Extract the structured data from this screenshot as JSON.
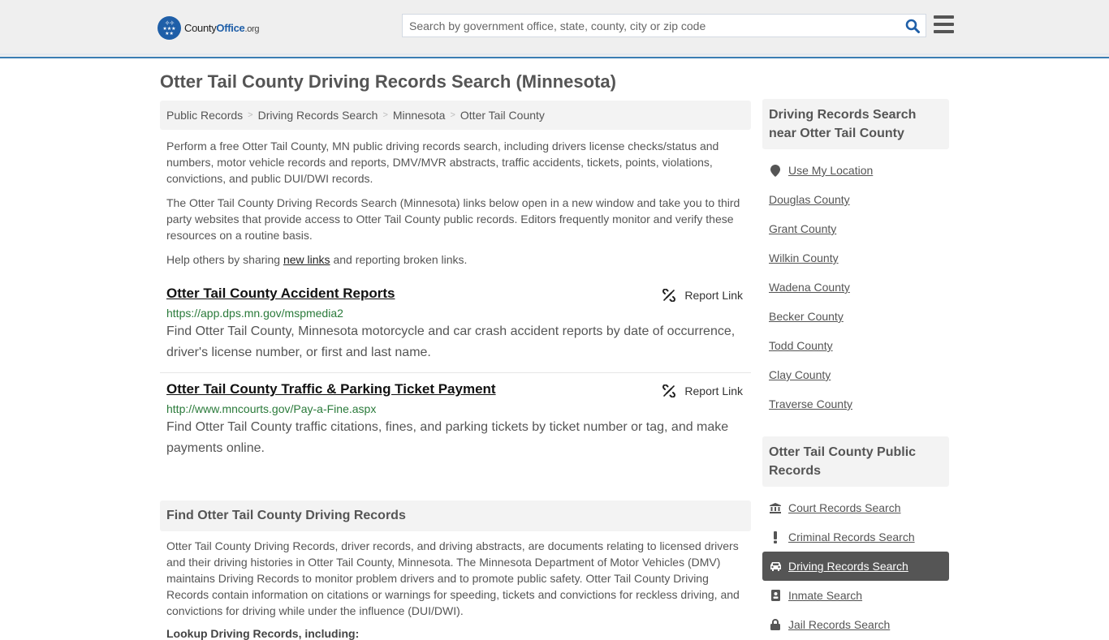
{
  "header": {
    "logo": {
      "county": "County",
      "office": "Office",
      "tld": ".org"
    },
    "search_placeholder": "Search by government office, state, county, city or zip code",
    "search_icon": "search-icon",
    "menu_icon": "hamburger-menu-icon",
    "accent_color": "#3a7db3"
  },
  "page": {
    "title": "Otter Tail County Driving Records Search (Minnesota)"
  },
  "breadcrumb": [
    {
      "label": "Public Records"
    },
    {
      "label": "Driving Records Search"
    },
    {
      "label": "Minnesota"
    },
    {
      "label": "Otter Tail County"
    }
  ],
  "intro": {
    "p1": "Perform a free Otter Tail County, MN public driving records search, including drivers license checks/status and numbers, motor vehicle records and reports, DMV/MVR abstracts, traffic accidents, tickets, points, violations, convictions, and public DUI/DWI records.",
    "p2": "The Otter Tail County Driving Records Search (Minnesota) links below open in a new window and take you to third party websites that provide access to Otter Tail County public records. Editors frequently monitor and verify these resources on a routine basis.",
    "p3_before": "Help others by sharing ",
    "p3_link": "new links",
    "p3_after": " and reporting broken links."
  },
  "links": [
    {
      "title": "Otter Tail County Accident Reports",
      "report_label": "Report Link",
      "url": "https://app.dps.mn.gov/mspmedia2",
      "description": "Find Otter Tail County, Minnesota motorcycle and car crash accident reports by date of occurrence, driver's license number, or first and last name."
    },
    {
      "title": "Otter Tail County Traffic & Parking Ticket Payment",
      "report_label": "Report Link",
      "url": "http://www.mncourts.gov/Pay-a-Fine.aspx",
      "description": "Find Otter Tail County traffic citations, fines, and parking tickets by ticket number or tag, and make payments online."
    }
  ],
  "find_section": {
    "heading": "Find Otter Tail County Driving Records",
    "body": "Otter Tail County Driving Records, driver records, and driving abstracts, are documents relating to licensed drivers and their driving histories in Otter Tail County, Minnesota. The Minnesota Department of Motor Vehicles (DMV) maintains Driving Records to monitor problem drivers and to promote public safety. Otter Tail County Driving Records contain information on citations or warnings for speeding, tickets and convictions for reckless driving, and convictions for driving while under the influence (DUI/DWI).",
    "subheading": "Lookup Driving Records, including:"
  },
  "sidebar": {
    "nearby_heading": "Driving Records Search near Otter Tail County",
    "use_location": "Use My Location",
    "nearby": [
      {
        "label": "Douglas County"
      },
      {
        "label": "Grant County"
      },
      {
        "label": "Wilkin County"
      },
      {
        "label": "Wadena County"
      },
      {
        "label": "Becker County"
      },
      {
        "label": "Todd County"
      },
      {
        "label": "Clay County"
      },
      {
        "label": "Traverse County"
      }
    ],
    "records_heading": "Otter Tail County Public Records",
    "records": [
      {
        "label": "Court Records Search",
        "icon": "courthouse-icon"
      },
      {
        "label": "Criminal Records Search",
        "icon": "exclamation-icon"
      },
      {
        "label": "Driving Records Search",
        "icon": "car-icon",
        "active": true
      },
      {
        "label": "Inmate Search",
        "icon": "id-badge-icon"
      },
      {
        "label": "Jail Records Search",
        "icon": "lock-icon"
      }
    ]
  }
}
